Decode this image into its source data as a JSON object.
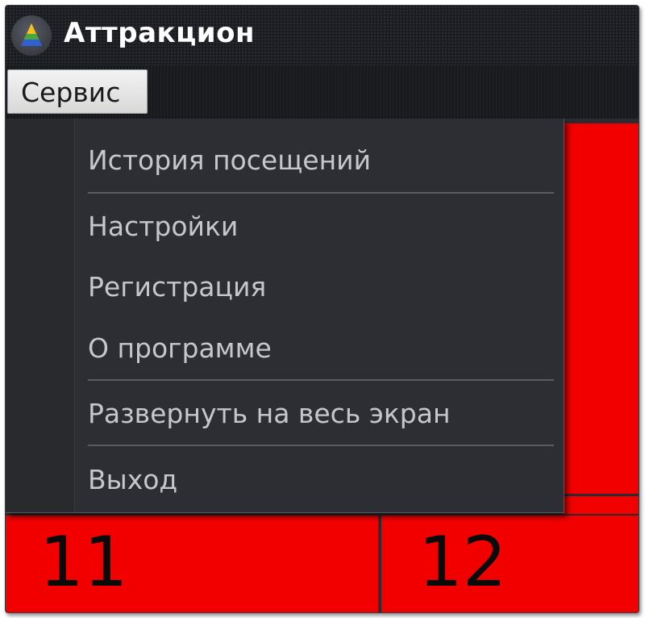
{
  "window": {
    "title": "Аттракцион",
    "icon": "pyramid-app-icon"
  },
  "menubar": {
    "service_label": "Сервис"
  },
  "menu": {
    "items": [
      {
        "label": "История посещений"
      },
      {
        "label": "Настройки"
      },
      {
        "label": "Регистрация"
      },
      {
        "label": "О программе"
      },
      {
        "label": "Развернуть на весь экран"
      },
      {
        "label": "Выход"
      }
    ]
  },
  "tiles": [
    {
      "number": "11"
    },
    {
      "number": "12"
    }
  ],
  "colors": {
    "tile_red": "#f20000",
    "menu_bg": "#2c2e33",
    "menu_text": "#c5c7cc"
  }
}
